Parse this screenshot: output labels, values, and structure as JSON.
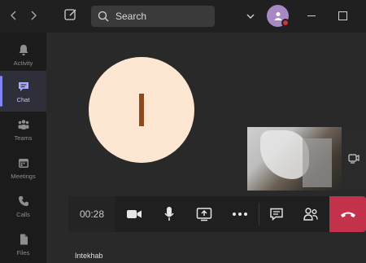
{
  "topbar": {
    "back": "‹",
    "forward": "›",
    "search_label": "Search"
  },
  "rail": {
    "items": [
      {
        "label": "Activity"
      },
      {
        "label": "Chat"
      },
      {
        "label": "Teams"
      },
      {
        "label": "Meetings"
      },
      {
        "label": "Calls"
      },
      {
        "label": "Files"
      }
    ]
  },
  "call": {
    "avatar_initial": "I",
    "timer": "00:28",
    "participant_name": "Intekhab"
  },
  "colors": {
    "accent": "#7f85f5",
    "hangup": "#c4314b",
    "avatar_bg": "#fde7d2",
    "avatar_fg": "#8b4a1b"
  }
}
